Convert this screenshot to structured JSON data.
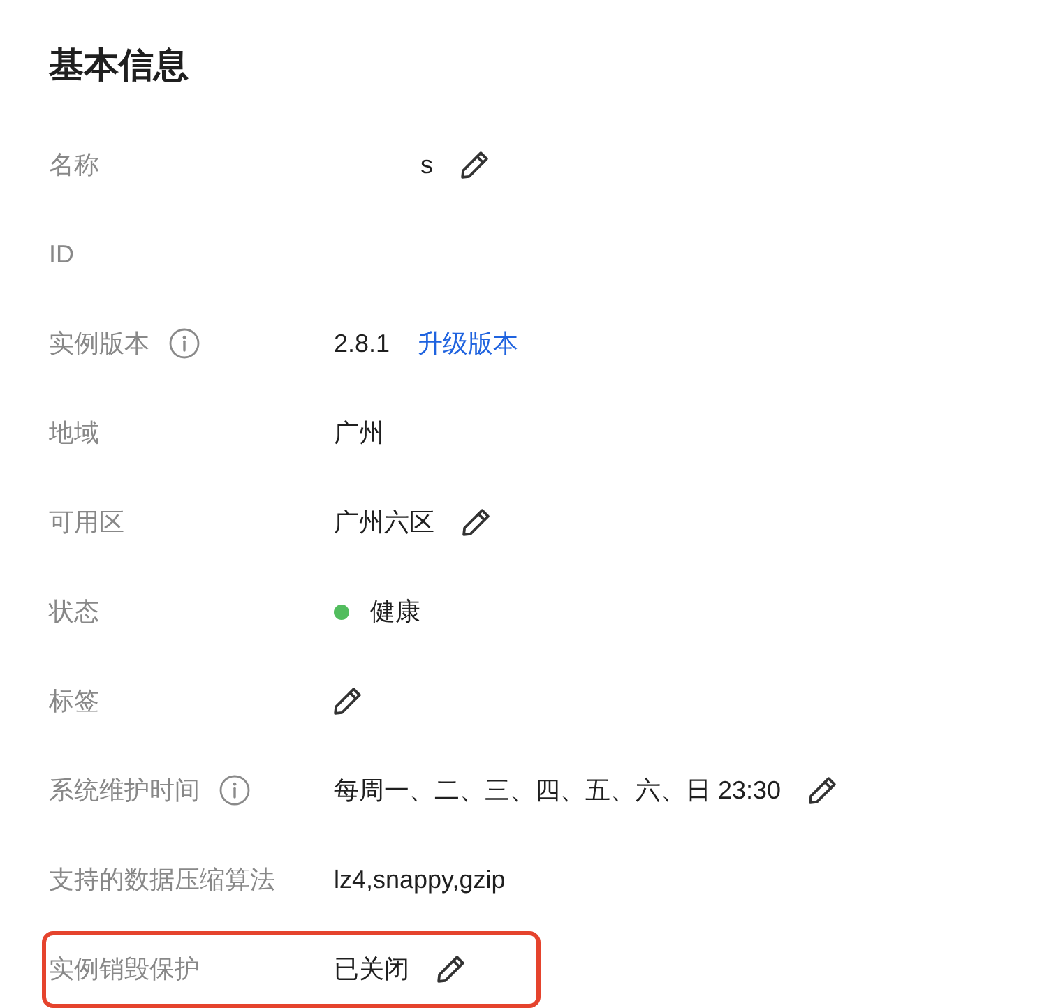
{
  "title": "基本信息",
  "rows": [
    {
      "label": "名称",
      "kind": "masked",
      "value": "s",
      "info": false,
      "editable": true,
      "highlighted": false
    },
    {
      "label": "ID",
      "kind": "empty",
      "info": false,
      "editable": false,
      "highlighted": false
    },
    {
      "label": "实例版本",
      "kind": "link",
      "value": "2.8.1",
      "link": "升级版本",
      "info": true,
      "editable": false,
      "highlighted": false
    },
    {
      "label": "地域",
      "kind": "text",
      "value": "广州",
      "info": false,
      "editable": false,
      "highlighted": false
    },
    {
      "label": "可用区",
      "kind": "text",
      "value": "广州六区",
      "info": false,
      "editable": true,
      "highlighted": false
    },
    {
      "label": "状态",
      "kind": "status",
      "value": "健康",
      "color": "#52bd5e",
      "info": false,
      "editable": false,
      "highlighted": false
    },
    {
      "label": "标签",
      "kind": "empty",
      "info": false,
      "editable": true,
      "highlighted": false
    },
    {
      "label": "系统维护时间",
      "kind": "text",
      "value": "每周一、二、三、四、五、六、日 23:30",
      "info": true,
      "editable": true,
      "highlighted": false
    },
    {
      "label": "支持的数据压缩算法",
      "kind": "text",
      "value": "lz4,snappy,gzip",
      "info": false,
      "editable": false,
      "highlighted": false
    },
    {
      "label": "实例销毁保护",
      "kind": "text",
      "value": "已关闭",
      "info": false,
      "editable": true,
      "highlighted": true
    }
  ]
}
